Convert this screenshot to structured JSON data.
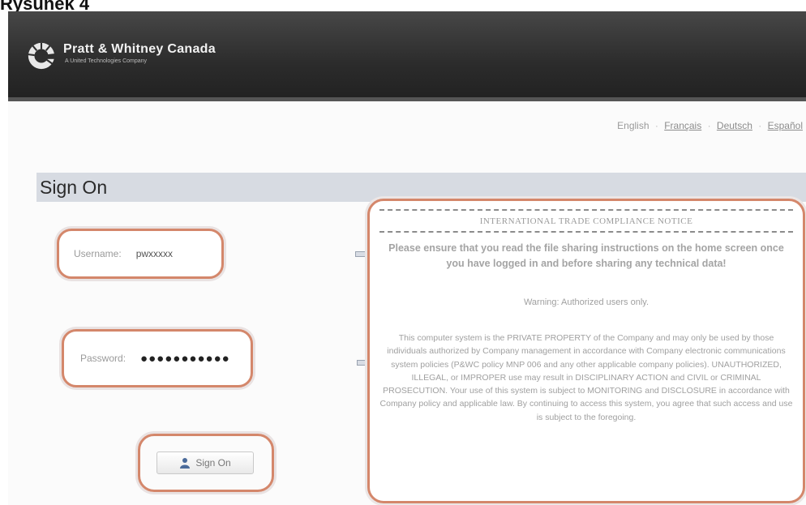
{
  "caption": "Rysunek 4",
  "header": {
    "brand_name": "Pratt & Whitney Canada",
    "brand_tagline": "A United Technologies Company"
  },
  "languages": [
    "English",
    "Français",
    "Deutsch",
    "Español"
  ],
  "page_title": "Sign On",
  "login": {
    "username_label": "Username:",
    "username_value": "pwxxxxx",
    "password_label": "Password:",
    "password_value": "●●●●●●●●●●●",
    "signon_button": "Sign On"
  },
  "notice": {
    "title": "INTERNATIONAL TRADE COMPLIANCE NOTICE",
    "share_text": "Please ensure that you read the file sharing instructions on the home screen once you have logged in and before sharing any technical data!",
    "warning": "Warning: Authorized users only.",
    "legal": "This computer system is the PRIVATE PROPERTY of the Company and may only be used by those individuals authorized by Company management in accordance with Company electronic communications system policies (P&WC policy MNP 006 and any other applicable company policies). UNAUTHORIZED, ILLEGAL, or IMPROPER use may result in DISCIPLINARY ACTION and CIVIL or CRIMINAL PROSECUTION. Your use of this system is subject to MONITORING and DISCLOSURE in accordance with Company policy and applicable law. By continuing to access this system, you agree that such access and use is subject to the foregoing."
  },
  "colors": {
    "header_bg": "#2c2c2c",
    "highlight_outline": "#d4876b",
    "title_bar": "#d7dbe2"
  }
}
